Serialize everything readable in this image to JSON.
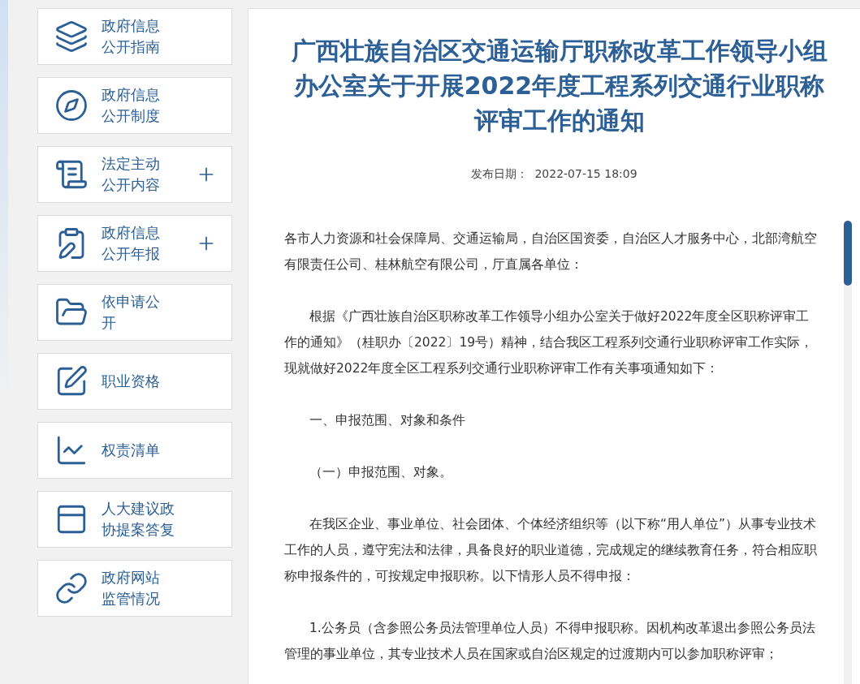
{
  "sidebar": {
    "items": [
      {
        "label": "政府信息公开指南",
        "expandable": false
      },
      {
        "label": "政府信息公开制度",
        "expandable": false
      },
      {
        "label": "法定主动公开内容",
        "expandable": true
      },
      {
        "label": "政府信息公开年报",
        "expandable": true
      },
      {
        "label": "依申请公开",
        "expandable": false
      },
      {
        "label": "职业资格",
        "expandable": false
      },
      {
        "label": "权责清单",
        "expandable": false
      },
      {
        "label": "人大建议政协提案答复",
        "expandable": false
      },
      {
        "label": "政府网站监管情况",
        "expandable": false
      }
    ]
  },
  "article": {
    "title": "广西壮族自治区交通运输厅职称改革工作领导小组办公室关于开展2022年度工程系列交通行业职称评审工作的通知",
    "date_label": "发布日期：",
    "date": "2022-07-15 18:09",
    "paragraphs": [
      {
        "text": "各市人力资源和社会保障局、交通运输局，自治区国资委，自治区人才服务中心，北部湾航空有限责任公司、桂林航空有限公司，厅直属各单位：",
        "indent": false
      },
      {
        "text": "根据《广西壮族自治区职称改革工作领导小组办公室关于做好2022年度全区职称评审工作的通知》（桂职办〔2022〕19号）精神，结合我区工程系列交通行业职称评审工作实际，现就做好2022年度全区工程系列交通行业职称评审工作有关事项通知如下：",
        "indent": true
      },
      {
        "text": "一、申报范围、对象和条件",
        "indent": true
      },
      {
        "text": "（一）申报范围、对象。",
        "indent": true
      },
      {
        "text": "在我区企业、事业单位、社会团体、个体经济组织等（以下称“用人单位”）从事专业技术工作的人员，遵守宪法和法律，具备良好的职业道德，完成规定的继续教育任务，符合相应职称申报条件的，可按规定申报职称。以下情形人员不得申报：",
        "indent": true
      },
      {
        "text": "1.公务员（含参照公务员法管理单位人员）不得申报职称。因机构改革退出参照公务员法管理的事业单位，其专业技术人员在国家或自治区规定的过渡期内可以参加职称评审；",
        "indent": true
      }
    ]
  }
}
